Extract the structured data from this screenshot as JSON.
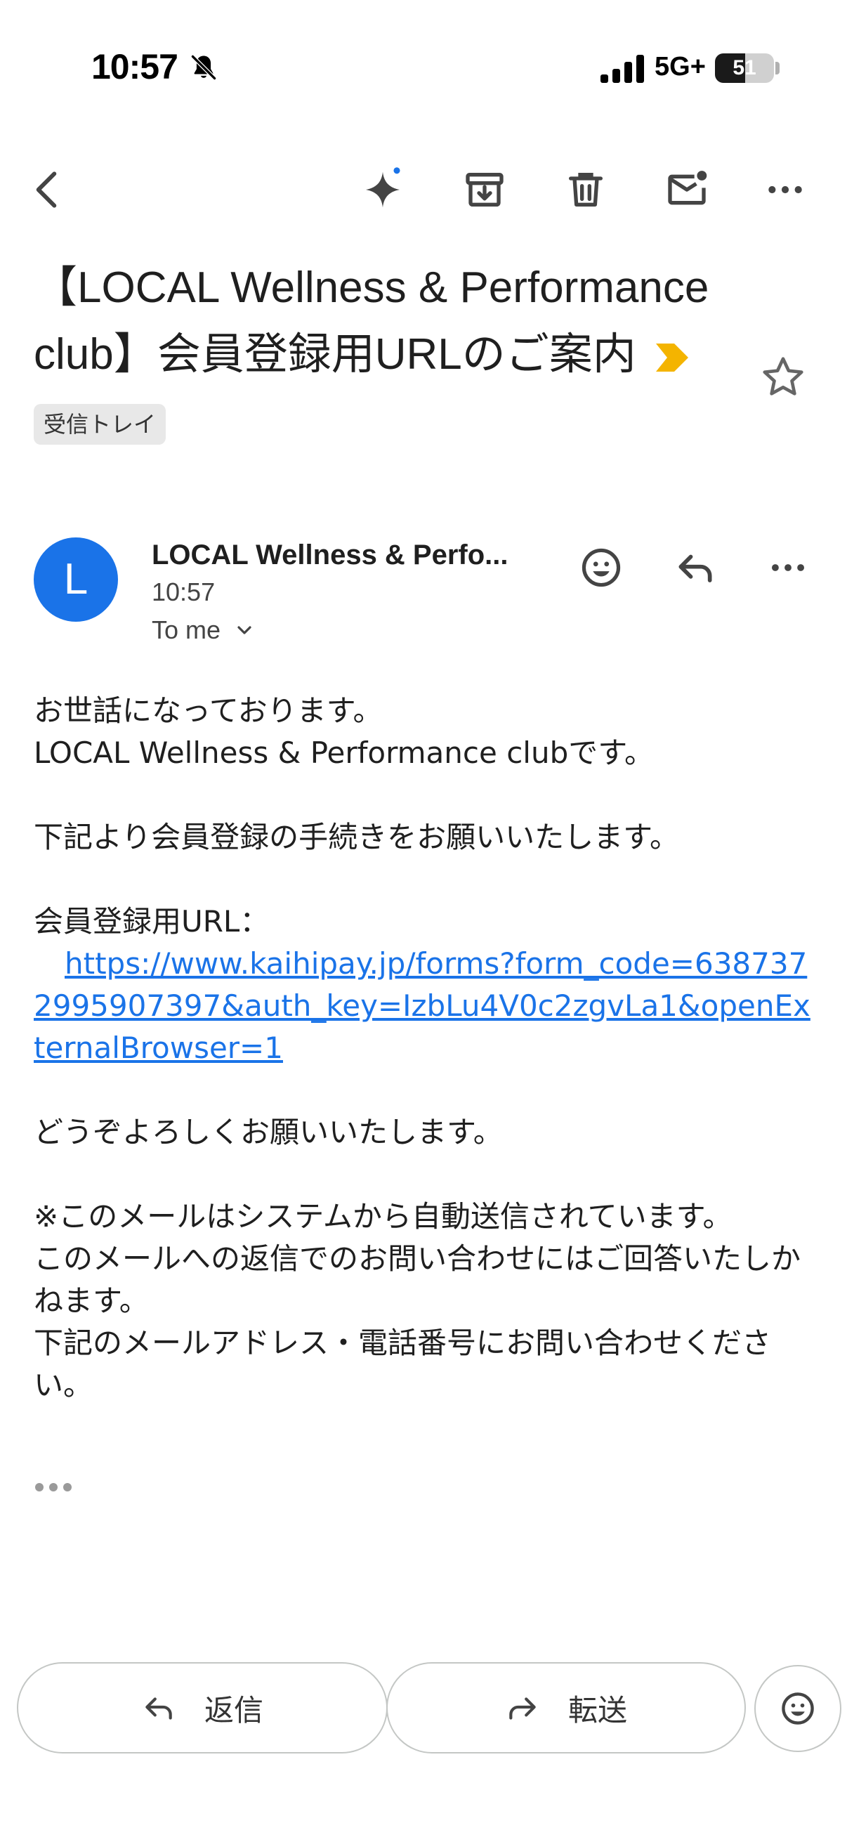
{
  "status_bar": {
    "time": "10:57",
    "network": "5G+",
    "battery_level": 51,
    "battery_label": "51"
  },
  "toolbar": {
    "icons": [
      "back-arrow-icon",
      "gemini-sparkle-icon",
      "archive-icon",
      "trash-icon",
      "mark-unread-icon",
      "more-vert-icon"
    ],
    "notification_dot_color": "#1a73e8"
  },
  "email": {
    "subject": "【LOCAL Wellness & Performance club】会員登録用URLのご案内",
    "label": "受信トレイ",
    "label_arrow_color": "#f4b400",
    "sender": {
      "initial": "L",
      "name": "LOCAL Wellness & Perfo...",
      "time": "10:57",
      "recipient": "To me",
      "avatar_color": "#1a73e8"
    },
    "body": {
      "greeting": "お世話になっております。",
      "from_line": "LOCAL Wellness & Performance clubです。",
      "request": "下記より会員登録の手続きをお願いいたします。",
      "url_label": "会員登録用URL：",
      "url": "https://www.kaihipay.jp/forms?form_code=6387372995907397&auth_key=IzbLu4V0c2zgvLa1&openExternalBrowser=1",
      "closing": "どうぞよろしくお願いいたします。",
      "note_1": "※このメールはシステムから自動送信されています。",
      "note_2": "このメールへの返信でのお問い合わせにはご回答いたしかねます。",
      "note_3": "下記のメールアドレス・電話番号にお問い合わせください。"
    }
  },
  "actions": {
    "reply_label": "返信",
    "forward_label": "転送"
  }
}
